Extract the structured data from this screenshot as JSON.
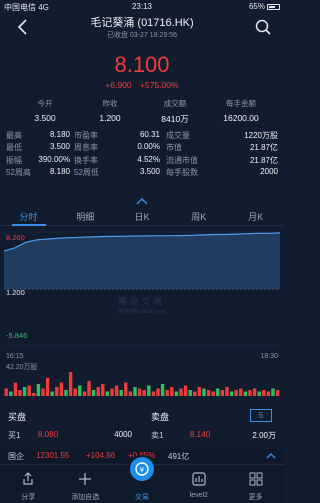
{
  "status": {
    "carrier": "中国电信",
    "network": "4G",
    "time": "23:13",
    "battery": "65%"
  },
  "header": {
    "title": "毛记葵涌 (01716.HK)",
    "subtitle": "已收盘 03-27 18:29:56"
  },
  "quote": {
    "price": "8.100",
    "change": "+6.900",
    "change_pct": "+575.00%"
  },
  "summary": [
    {
      "label": "今开",
      "value": "3.500"
    },
    {
      "label": "昨收",
      "value": "1.200"
    },
    {
      "label": "成交额",
      "value": "8410万"
    },
    {
      "label": "每手金额",
      "value": "16200.00"
    }
  ],
  "stats": [
    [
      "最高",
      "8.180",
      "市盈率",
      "60.31",
      "成交量",
      "1220万股"
    ],
    [
      "最低",
      "3.500",
      "周息率",
      "0.00%",
      "市值",
      "21.87亿"
    ],
    [
      "振幅",
      "390.00%",
      "换手率",
      "4.52%",
      "流通市值",
      "21.87亿"
    ],
    [
      "52周高",
      "8.180",
      "52周低",
      "3.500",
      "每手股数",
      "2000"
    ]
  ],
  "tabs": [
    "分时",
    "明细",
    "日K",
    "周K",
    "月K"
  ],
  "chart_data": {
    "type": "area",
    "ylim": [
      -5.846,
      8.26
    ],
    "y_top_label": "8.260",
    "y_mid_label": "1.200",
    "y_bottom_label": "-5.846",
    "start_time": "16:15",
    "end_time": "18:30",
    "volume_label": "42.20万股",
    "series": [
      {
        "values": [
          5.9,
          6.3,
          7.0,
          7.3,
          7.4,
          7.5,
          7.55,
          7.6,
          7.65,
          7.7,
          7.72,
          7.74,
          7.76,
          7.78,
          7.8,
          7.8,
          7.82,
          7.85,
          7.9,
          7.95,
          7.95,
          8.0,
          8.05,
          8.1,
          8.1,
          8.15
        ]
      }
    ],
    "volumes": [
      5,
      3,
      9,
      4,
      6,
      7,
      2,
      8,
      5,
      12,
      3,
      6,
      9,
      4,
      16,
      5,
      7,
      3,
      10,
      4,
      6,
      8,
      3,
      5,
      7,
      4,
      9,
      3,
      6,
      5,
      4,
      7,
      3,
      5,
      8,
      4,
      6,
      3,
      5,
      7,
      4,
      3,
      6,
      5,
      4,
      3,
      5,
      4,
      6,
      3,
      4,
      5,
      3,
      4,
      5,
      3,
      4,
      3,
      5,
      4
    ]
  },
  "watermark": {
    "line1": "福盈交易",
    "line2": "复盛新股Vgk3d7.com"
  },
  "orderbook": {
    "bid_title": "买盘",
    "ask_title": "卖盘",
    "depth": "5",
    "bid": {
      "label": "买1",
      "price": "8.080",
      "qty": "4000"
    },
    "ask": {
      "label": "卖1",
      "price": "8.140",
      "qty": "2.00万"
    }
  },
  "ticker": {
    "name": "国企",
    "value": "12301.55",
    "change": "+104.56",
    "pct": "+0.85%",
    "volume": "491亿"
  },
  "nav": [
    {
      "label": "分享"
    },
    {
      "label": "添加自选"
    },
    {
      "label": "交易"
    },
    {
      "label": "level2"
    },
    {
      "label": "更多"
    }
  ],
  "colors": {
    "up": "#ef3b3b",
    "accent": "#3d8fe6",
    "bg": "#111d2e",
    "down": "#2fbf5f"
  }
}
